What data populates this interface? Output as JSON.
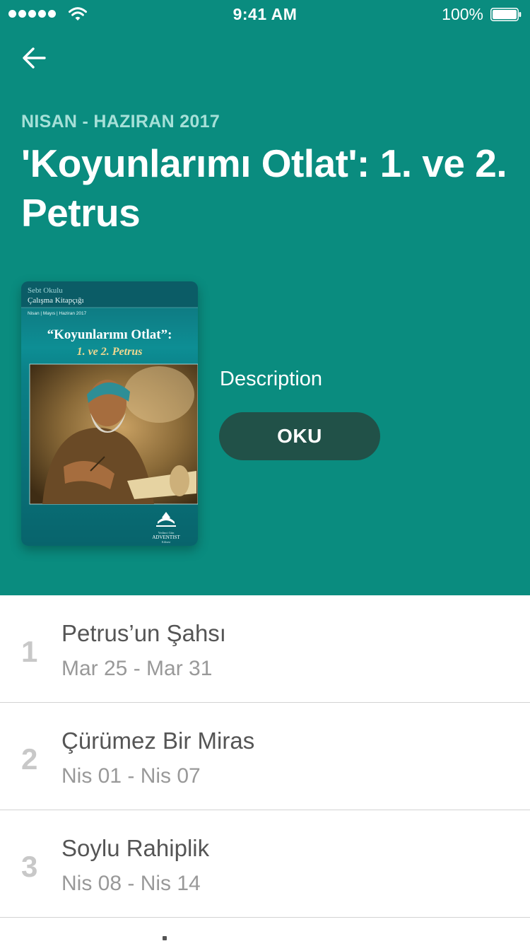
{
  "status_bar": {
    "time": "9:41 AM",
    "battery": "100%"
  },
  "header": {
    "quarter": "NISAN - HAZIRAN 2017",
    "title": "'Koyunlarımı Otlat': 1. ve 2. Petrus",
    "description_label": "Description",
    "read_button_label": "OKU",
    "background_color": "#0a8c7f",
    "button_color": "#215148"
  },
  "cover": {
    "series_line1": "Sebt Okulu",
    "series_line2": "Çalışma Kitapçığı",
    "months": "Nisan | Mayıs | Haziran 2017",
    "title_line1": "“Koyunlarımı Otlat”:",
    "title_line2": "1. ve 2. Petrus",
    "logo_text1": "Yedinci Gün",
    "logo_text2": "ADVENTIST",
    "logo_text3": "Kilisesi"
  },
  "lessons": [
    {
      "number": "1",
      "title": "Petrus’un Şahsı",
      "dates": "Mar 25 - Mar 31"
    },
    {
      "number": "2",
      "title": "Çürümez Bir Miras",
      "dates": "Nis 01 - Nis 07"
    },
    {
      "number": "3",
      "title": "Soylu Rahiplik",
      "dates": "Nis 08 - Nis 14"
    }
  ]
}
